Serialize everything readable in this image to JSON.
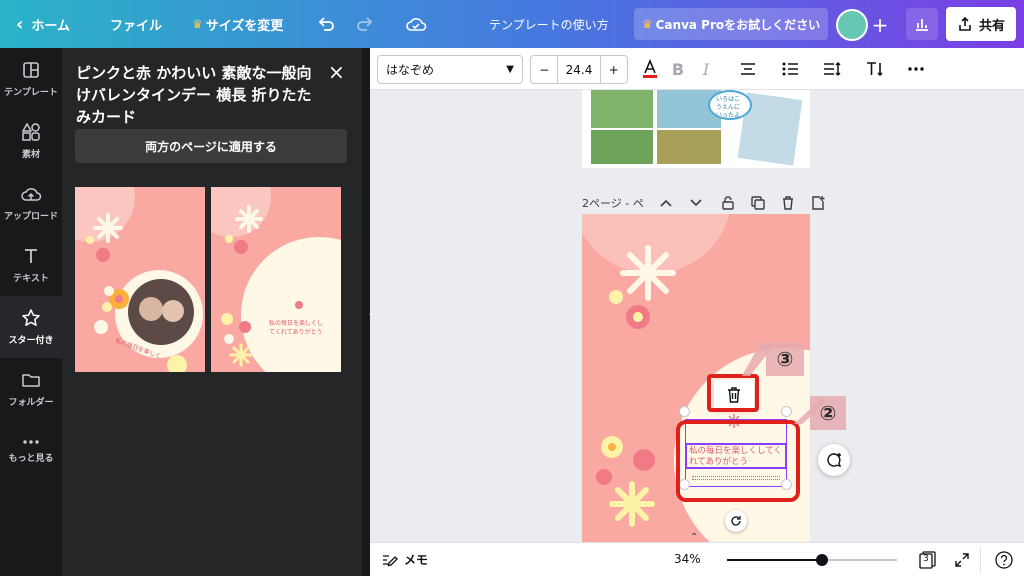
{
  "topbar": {
    "home_label": "ホーム",
    "file_label": "ファイル",
    "resize_label": "サイズを変更",
    "template_usage_label": "テンプレートの使い方",
    "pro_label": "Canva Proをお試しください",
    "share_label": "共有"
  },
  "sidebar": {
    "items": [
      {
        "label": "テンプレート",
        "icon": "template-icon"
      },
      {
        "label": "素材",
        "icon": "elements-icon"
      },
      {
        "label": "アップロード",
        "icon": "upload-icon"
      },
      {
        "label": "テキスト",
        "icon": "text-icon"
      },
      {
        "label": "スター付き",
        "icon": "star-icon"
      },
      {
        "label": "フォルダー",
        "icon": "folder-icon"
      },
      {
        "label": "もっと見る",
        "icon": "more-icon"
      }
    ],
    "active_index": 4
  },
  "panel": {
    "title": "ピンクと赤 かわいい 素敵な一般向けバレンタインデー 横長 折りたたみカード",
    "apply_button": "両方のページに適用する"
  },
  "toolbar": {
    "font_name": "はなぞめ",
    "font_size": "24.4",
    "minus": "−",
    "plus": "+"
  },
  "canvas": {
    "page1_badge": "いろはこうえんにいったよ",
    "page_label": "2ページ - ペ",
    "card_text": "私の毎日を楽しくしてくれてありがとう",
    "thumb_text_line1": "私の毎日を楽しくし",
    "thumb_text_line2": "てくれてありがとう",
    "callout_2": "②",
    "callout_3": "③",
    "highlight_color": "#e0201b",
    "accent_pink": "#f9a8a2"
  },
  "bottombar": {
    "memo_label": "メモ",
    "zoom_label": "34%",
    "zoom_fraction": 0.34,
    "page_count": "3"
  }
}
